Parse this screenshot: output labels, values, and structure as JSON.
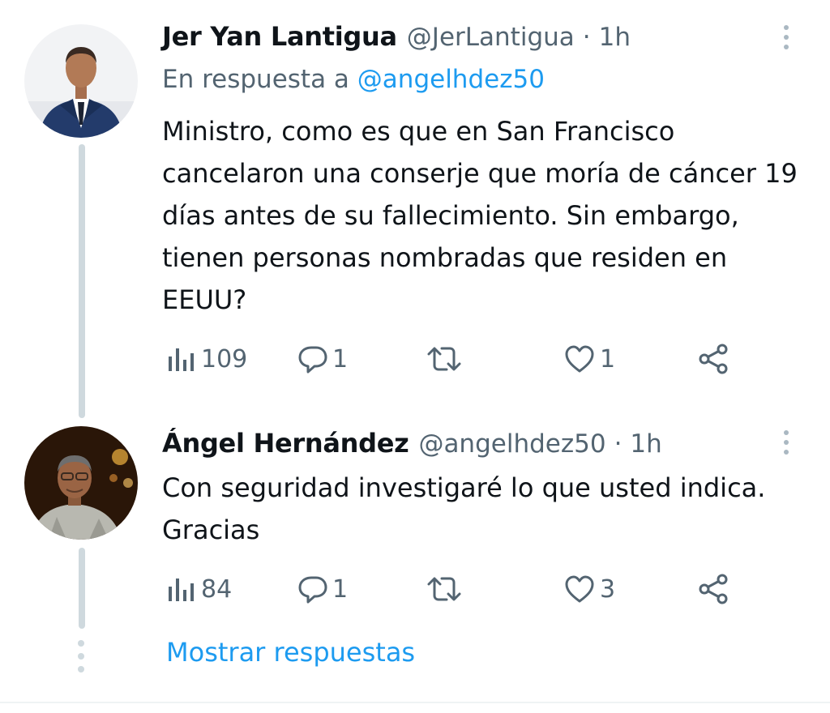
{
  "tweets": [
    {
      "display_name": "Jer Yan Lantigua",
      "handle": "@JerLantigua",
      "separator": "·",
      "time": "1h",
      "reply_prefix": "En respuesta a",
      "reply_to": "@angelhdez50",
      "text": "Ministro, como es que en San Francisco cancelaron una conserje que moría de cáncer 19 días antes de su fallecimiento. Sin embargo, tienen personas nombradas que residen en EEUU?",
      "views": "109",
      "replies": "1",
      "retweets": "",
      "likes": "1",
      "avatar_icon": "user-avatar-suit"
    },
    {
      "display_name": "Ángel Hernández",
      "handle": "@angelhdez50",
      "separator": "·",
      "time": "1h",
      "text": "Con seguridad investigaré lo que usted indica. Gracias",
      "views": "84",
      "replies": "1",
      "retweets": "",
      "likes": "3",
      "avatar_icon": "user-avatar-man"
    }
  ],
  "show_replies_label": "Mostrar respuestas",
  "colors": {
    "link": "#1d9bf0",
    "secondary_text": "#536471",
    "primary_text": "#0f1419",
    "thread_line": "#cfd9de"
  }
}
